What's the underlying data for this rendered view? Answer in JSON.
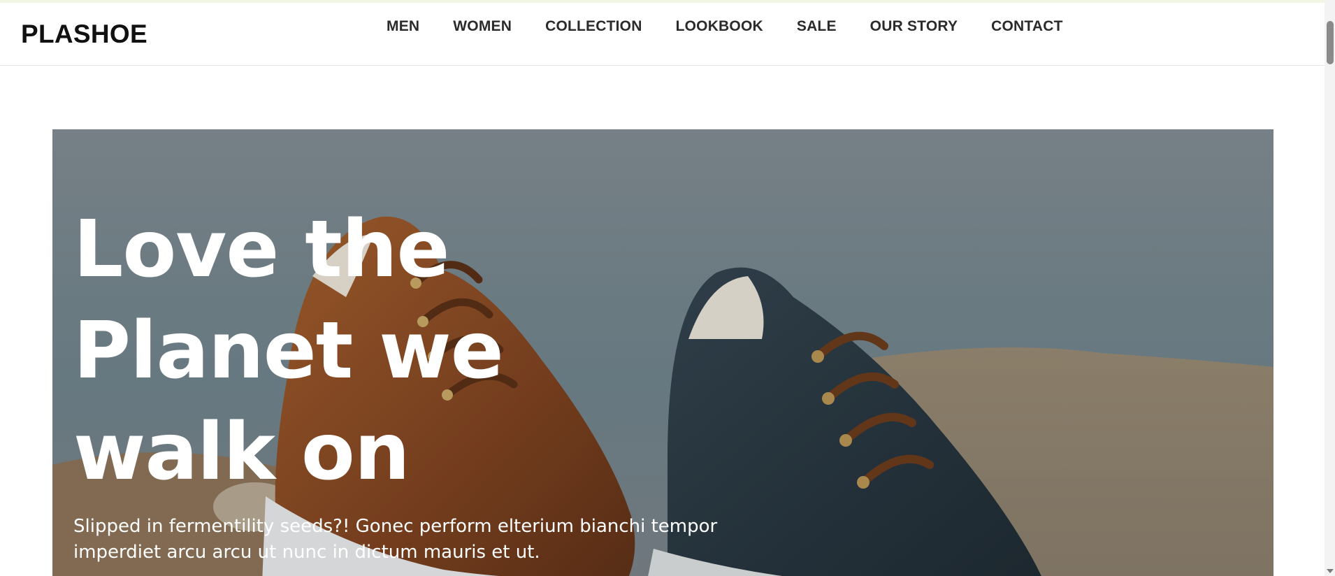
{
  "brand": {
    "name": "PLASHOE"
  },
  "nav": {
    "items": [
      {
        "label": "MEN"
      },
      {
        "label": "WOMEN"
      },
      {
        "label": "COLLECTION"
      },
      {
        "label": "LOOKBOOK"
      },
      {
        "label": "SALE"
      },
      {
        "label": "OUR STORY"
      },
      {
        "label": "CONTACT"
      }
    ]
  },
  "hero": {
    "headline_line1": "Love the",
    "headline_line2": "Planet we",
    "headline_line3": "walk on",
    "subtext": "Slipped in fermentility seeds?! Gonec perform elterium bianchi tempor imperdiet arcu arcu ut nunc in dictum mauris et ut.",
    "image": "shoes-on-rock"
  },
  "colors": {
    "text_dark": "#111111",
    "nav_text": "#2b2b2b",
    "hero_text": "#ffffff",
    "brown_shoe": "#8a4a22",
    "navy_shoe": "#2b3a44"
  }
}
